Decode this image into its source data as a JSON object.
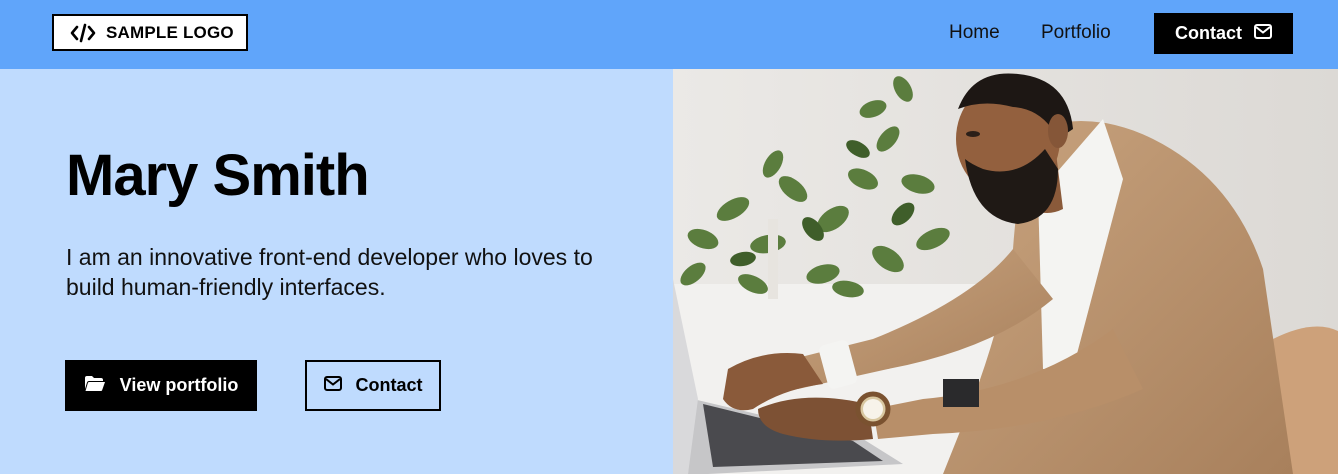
{
  "header": {
    "logo_text": "SAMPLE LOGO",
    "logo_icon": "code-icon",
    "nav": {
      "home": "Home",
      "portfolio": "Portfolio",
      "contact": "Contact",
      "contact_icon": "envelope-icon"
    }
  },
  "hero": {
    "name": "Mary Smith",
    "tagline": "I am an innovative front-end developer who loves to build human-friendly interfaces.",
    "primary_button": {
      "label": "View portfolio",
      "icon": "folder-open-icon"
    },
    "secondary_button": {
      "label": "Contact",
      "icon": "envelope-icon"
    },
    "photo": {
      "alt": "Man with beard in tan blazer typing on a laptop next to a potted plant"
    }
  },
  "colors": {
    "header_bg": "#60a5fa",
    "hero_bg": "#bfdbfe",
    "primary": "#000000",
    "button_text": "#ffffff"
  }
}
